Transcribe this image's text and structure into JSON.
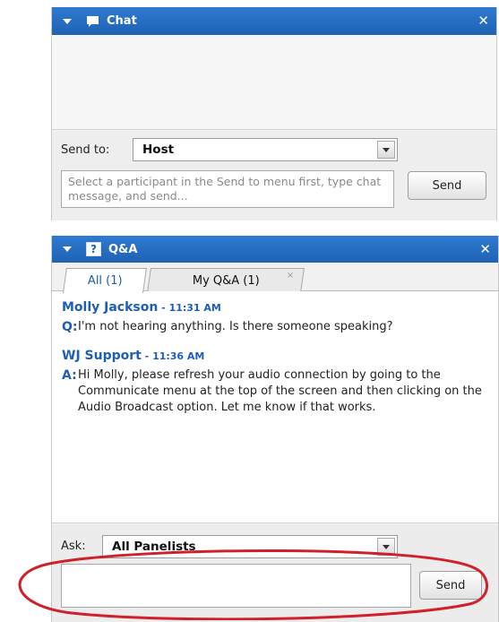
{
  "chat": {
    "title": "Chat",
    "send_to_label": "Send to:",
    "send_to_value": "Host",
    "message_placeholder": "Select a participant in the Send to menu first, type chat message, and send...",
    "send_label": "Send",
    "close_glyph": "✕"
  },
  "qa": {
    "title": "Q&A",
    "icon_glyph": "?",
    "close_glyph": "✕",
    "tabs": [
      {
        "label": "All (1)",
        "active": true
      },
      {
        "label": "My Q&A (1)",
        "active": false,
        "close_glyph": "×"
      }
    ],
    "messages": [
      {
        "author": "Molly Jackson",
        "time": " - 11:31 AM",
        "prefix": "Q:",
        "text": "I'm not hearing anything. Is there someone speaking?"
      },
      {
        "author": "WJ Support",
        "time": " - 11:36 AM",
        "prefix": "A:",
        "text": "Hi Molly, please refresh your audio connection by going to the Communicate menu at the top of the screen and then clicking on the Audio Broadcast option. Let me know if that works."
      }
    ],
    "ask_label": "Ask:",
    "ask_value": "All Panelists",
    "send_label": "Send",
    "input_value": ""
  },
  "colors": {
    "titlebar": "#1f62b4",
    "accent_text": "#1f5eb6",
    "annotation": "#d0202a"
  }
}
